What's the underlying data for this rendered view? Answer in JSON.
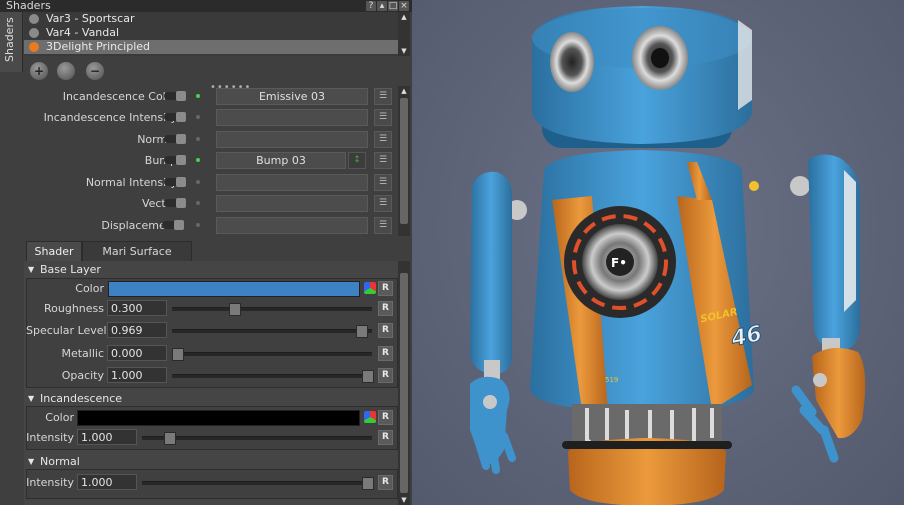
{
  "panel": {
    "title": "Shaders",
    "controls": [
      "?",
      "▴",
      "□",
      "×"
    ],
    "side_tab": "Shaders"
  },
  "shader_list": [
    {
      "name": "Var3 - Sportscar",
      "selected": false
    },
    {
      "name": "Var4 - Vandal",
      "selected": false
    },
    {
      "name": "3Delight Principled",
      "selected": true
    }
  ],
  "toolbar": {
    "add_icon": "add-shader-icon",
    "sphere_icon": "shader-ball-icon",
    "remove_icon": "remove-shader-icon"
  },
  "channels": [
    {
      "label": "Incandescence Color",
      "value": "Emissive 03",
      "active": true
    },
    {
      "label": "Incandescence Intensity",
      "value": "",
      "active": false
    },
    {
      "label": "Normal",
      "value": "",
      "active": false
    },
    {
      "label": "Bump",
      "value": "Bump 03",
      "active": true
    },
    {
      "label": "Normal Intensity",
      "value": "",
      "active": false
    },
    {
      "label": "Vector",
      "value": "",
      "active": false
    },
    {
      "label": "Displacement",
      "value": "",
      "active": false
    }
  ],
  "tabs": {
    "shader": "Shader",
    "mari_surface": "Mari Surface"
  },
  "base_layer": {
    "title": "Base Layer",
    "color_label": "Color",
    "color": "#3d82c4",
    "roughness": {
      "label": "Roughness",
      "value": "0.300",
      "fraction": 0.3
    },
    "specular_level": {
      "label": "Specular Level",
      "value": "0.969",
      "fraction": 0.969
    },
    "metallic": {
      "label": "Metallic",
      "value": "0.000",
      "fraction": 0.0
    },
    "opacity": {
      "label": "Opacity",
      "value": "1.000",
      "fraction": 1.0
    }
  },
  "incandescence": {
    "title": "Incandescence",
    "color_label": "Color",
    "color": "#000000",
    "intensity": {
      "label": "Intensity",
      "value": "1.000",
      "fraction": 0.1
    }
  },
  "normal": {
    "title": "Normal",
    "intensity": {
      "label": "Intensity",
      "value": "1.000",
      "fraction": 1.0
    }
  },
  "reset_label": "R",
  "robot": {
    "colors": {
      "blue": "#3f93cc",
      "orange": "#e2892d",
      "metal": "#c9c9c9",
      "dark": "#2a2a2a"
    },
    "badge_text": "46",
    "brand_text": "SOLAR",
    "logo_text": "F•",
    "small_number": "519"
  }
}
